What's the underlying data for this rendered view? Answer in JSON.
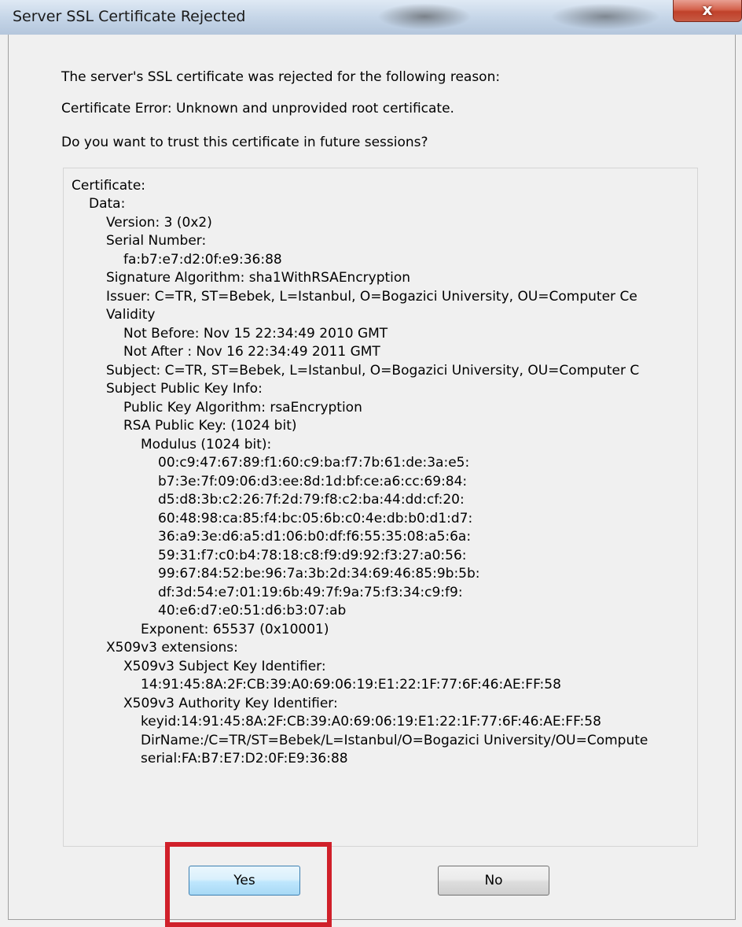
{
  "window": {
    "title": "Server SSL Certificate Rejected",
    "close_label": "x"
  },
  "messages": {
    "reason_intro": "The server's SSL certificate was rejected for the following reason:",
    "error": "Certificate Error: Unknown and unprovided root certificate.",
    "question": "Do you want to trust this certificate in future sessions?"
  },
  "certificate_lines": [
    "Certificate:",
    "Data:",
    "Version: 3 (0x2)",
    "Serial Number:",
    "fa:b7:e7:d2:0f:e9:36:88",
    "Signature Algorithm: sha1WithRSAEncryption",
    "Issuer: C=TR, ST=Bebek, L=Istanbul, O=Bogazici University, OU=Computer Ce",
    "Validity",
    "Not Before: Nov 15 22:34:49 2010 GMT",
    "Not After : Nov 16 22:34:49 2011 GMT",
    "Subject: C=TR, ST=Bebek, L=Istanbul, O=Bogazici University, OU=Computer C",
    "Subject Public Key Info:",
    "Public Key Algorithm: rsaEncryption",
    "RSA Public Key: (1024 bit)",
    "Modulus (1024 bit):",
    "00:c9:47:67:89:f1:60:c9:ba:f7:7b:61:de:3a:e5:",
    "b7:3e:7f:09:06:d3:ee:8d:1d:bf:ce:a6:cc:69:84:",
    "d5:d8:3b:c2:26:7f:2d:79:f8:c2:ba:44:dd:cf:20:",
    "60:48:98:ca:85:f4:bc:05:6b:c0:4e:db:b0:d1:d7:",
    "36:a9:3e:d6:a5:d1:06:b0:df:f6:55:35:08:a5:6a:",
    "59:31:f7:c0:b4:78:18:c8:f9:d9:92:f3:27:a0:56:",
    "99:67:84:52:be:96:7a:3b:2d:34:69:46:85:9b:5b:",
    "df:3d:54:e7:01:19:6b:49:7f:9a:75:f3:34:c9:f9:",
    "40:e6:d7:e0:51:d6:b3:07:ab",
    "Exponent: 65537 (0x10001)",
    "X509v3 extensions:",
    "X509v3 Subject Key Identifier:",
    "14:91:45:8A:2F:CB:39:A0:69:06:19:E1:22:1F:77:6F:46:AE:FF:58",
    "X509v3 Authority Key Identifier:",
    "keyid:14:91:45:8A:2F:CB:39:A0:69:06:19:E1:22:1F:77:6F:46:AE:FF:58",
    "DirName:/C=TR/ST=Bebek/L=Istanbul/O=Bogazici University/OU=Compute",
    "serial:FA:B7:E7:D2:0F:E9:36:88"
  ],
  "buttons": {
    "yes": "Yes",
    "no": "No"
  },
  "colors": {
    "highlight": "#d0202a",
    "close_button": "#c0412a"
  }
}
